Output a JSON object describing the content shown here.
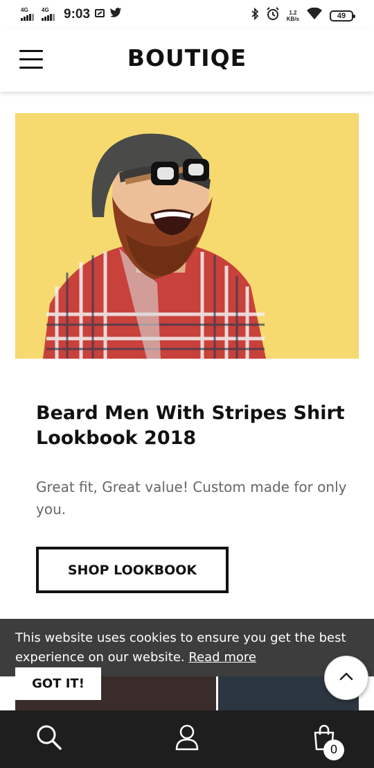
{
  "status_bar": {
    "network_1": "4G",
    "network_2": "4G",
    "time": "9:03",
    "speed_value": "1.2",
    "speed_unit": "KB/s",
    "battery": "49",
    "icons": [
      "signal-icon",
      "screenshot-icon",
      "twitter-icon",
      "bluetooth-icon",
      "alarm-icon",
      "wifi-icon",
      "battery-icon"
    ]
  },
  "header": {
    "menu_icon": "hamburger-menu-icon",
    "logo": "BOUTIQE"
  },
  "hero": {
    "image": "bearded-man-beanie-sunglasses-plaid-shirt",
    "background_color": "#f6d96f"
  },
  "lookbook": {
    "title": "Beard Men With Stripes Shirt Lookbook 2018",
    "description": "Great fit, Great value! Custom made for only you.",
    "button_label": "SHOP LOOKBOOK"
  },
  "cookie": {
    "message": "This website uses cookies to ensure you get the best experience on our website.",
    "link_label": "Read more",
    "accept_label": "GOT IT!"
  },
  "scroll_top": {
    "icon": "chevron-up-icon"
  },
  "bottom_nav": {
    "items": [
      "search-icon",
      "user-icon",
      "shopping-bag-icon"
    ],
    "cart_count": "0"
  },
  "colors": {
    "hero_bg": "#f6d96f",
    "cookie_bg": "#3d3d3d",
    "nav_bg": "#1e1e1e",
    "text_dark": "#111111",
    "text_muted": "#666666"
  }
}
